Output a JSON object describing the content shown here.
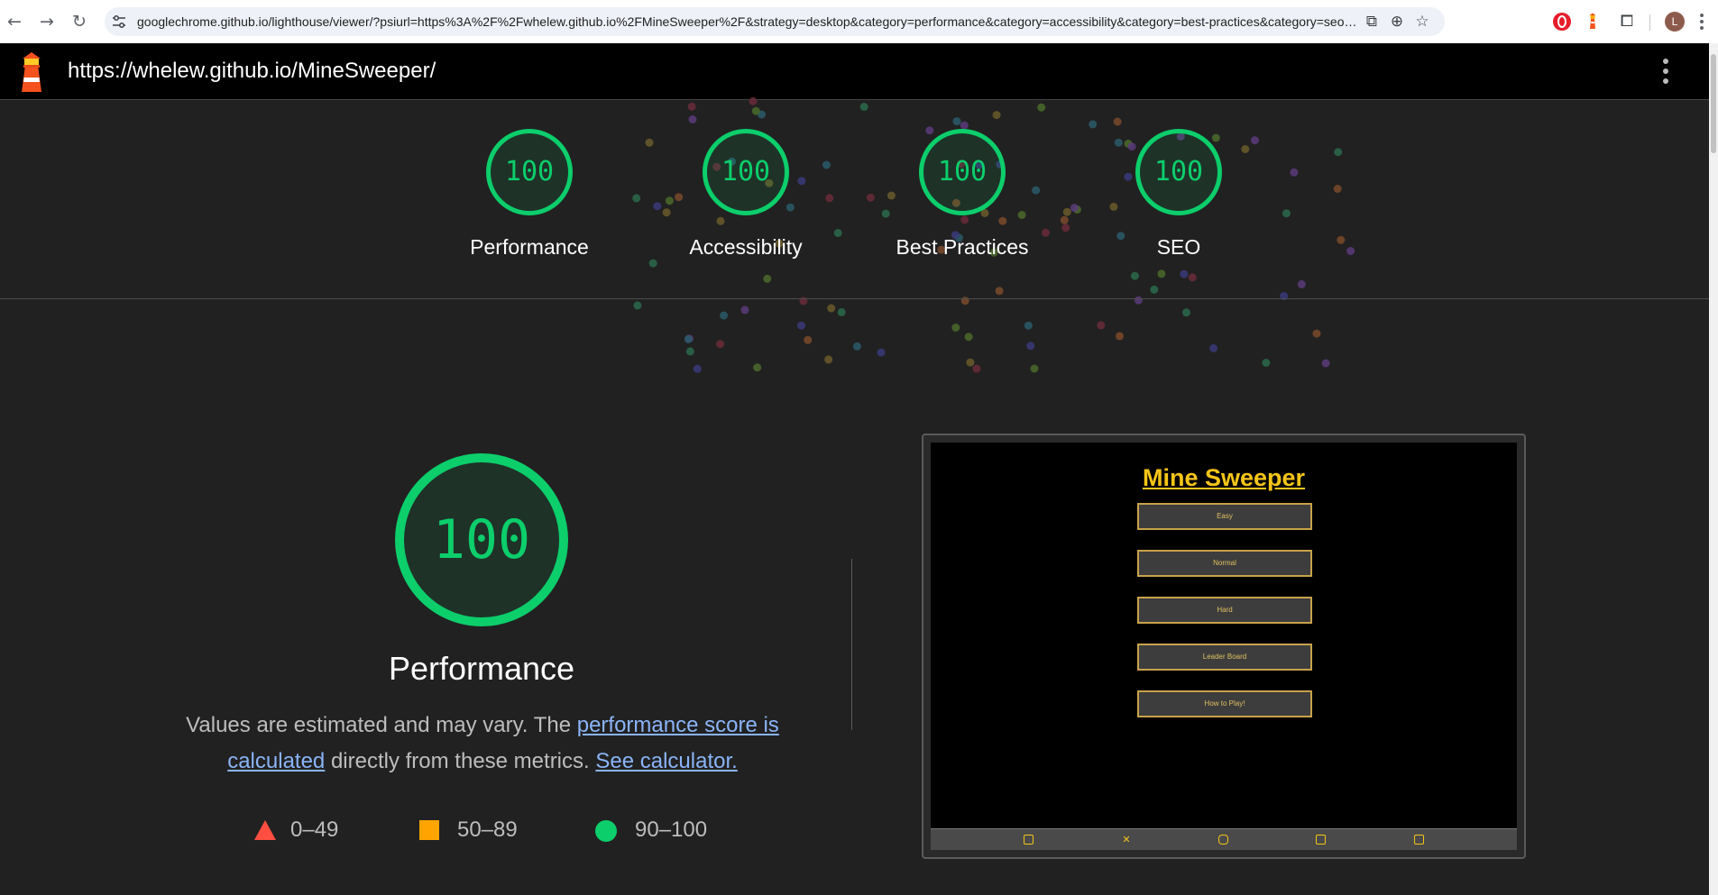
{
  "browser": {
    "url": "googlechrome.github.io/lighthouse/viewer/?psiurl=https%3A%2F%2Fwhelew.github.io%2FMineSweeper%2F&strategy=desktop&category=performance&category=accessibility&category=best-practices&category=seo&locale=en-G...",
    "profile_initial": "L",
    "icons": [
      "back-icon",
      "forward-icon",
      "reload-icon",
      "site-settings-icon",
      "install-app-icon",
      "zoom-icon",
      "star-icon",
      "opera-extension-icon",
      "lighthouse-extension-icon",
      "extensions-icon",
      "chrome-menu-icon"
    ]
  },
  "report": {
    "url": "https://whelew.github.io/MineSweeper/"
  },
  "gauges": [
    {
      "label": "Performance",
      "score": "100"
    },
    {
      "label": "Accessibility",
      "score": "100"
    },
    {
      "label": "Best Practices",
      "score": "100"
    },
    {
      "label": "SEO",
      "score": "100"
    }
  ],
  "performance": {
    "score": "100",
    "title": "Performance",
    "desc_prefix": "Values are estimated and may vary. The ",
    "link_score": "performance score is calculated",
    "desc_mid": " directly from these metrics. ",
    "link_calc": "See calculator."
  },
  "legend": [
    {
      "range": "0–49",
      "shape": "triangle",
      "color": "#ff4e42"
    },
    {
      "range": "50–89",
      "shape": "square",
      "color": "#ffa400"
    },
    {
      "range": "90–100",
      "shape": "circle",
      "color": "#0cce6b"
    }
  ],
  "screenshot": {
    "title": "Mine Sweeper",
    "buttons": [
      "Easy",
      "Normal",
      "Hard",
      "Leader Board",
      "How to Play!"
    ],
    "footer_icons": [
      "facebook-icon",
      "x-icon",
      "discord-icon",
      "instagram-icon",
      "youtube-icon"
    ]
  },
  "colors": {
    "pass": "#0cce6b",
    "average": "#ffa400",
    "fail": "#ff4e42",
    "link": "#8ab4f8",
    "game_accent": "#f5c518"
  }
}
